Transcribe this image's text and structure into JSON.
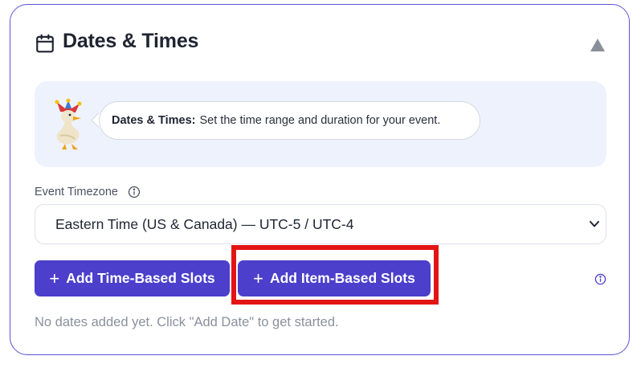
{
  "section": {
    "title": "Dates & Times",
    "icon": "calendar-icon",
    "collapse_icon": "caret-up-icon"
  },
  "helper": {
    "mascot_icon": "jester-duck-mascot",
    "strong_text": "Dates & Times:",
    "text": "Set the time range and duration for your event."
  },
  "timezone": {
    "label": "Event Timezone",
    "info_icon": "info-icon",
    "selected_value": "Eastern Time (US & Canada) — UTC-5 / UTC-4",
    "chevron_icon": "chevron-down-icon"
  },
  "actions": {
    "add_time_based_label": "Add Time-Based Slots",
    "add_item_based_label": "Add Item-Based Slots",
    "plus_icon": "plus-icon",
    "info_icon": "info-icon"
  },
  "empty_state": {
    "message": "No dates added yet. Click \"Add Date\" to get started."
  },
  "colors": {
    "accent": "#4b3fcb",
    "card_border": "#5b54d6",
    "highlight": "#e31414",
    "panel_bg": "#eef2fd"
  }
}
